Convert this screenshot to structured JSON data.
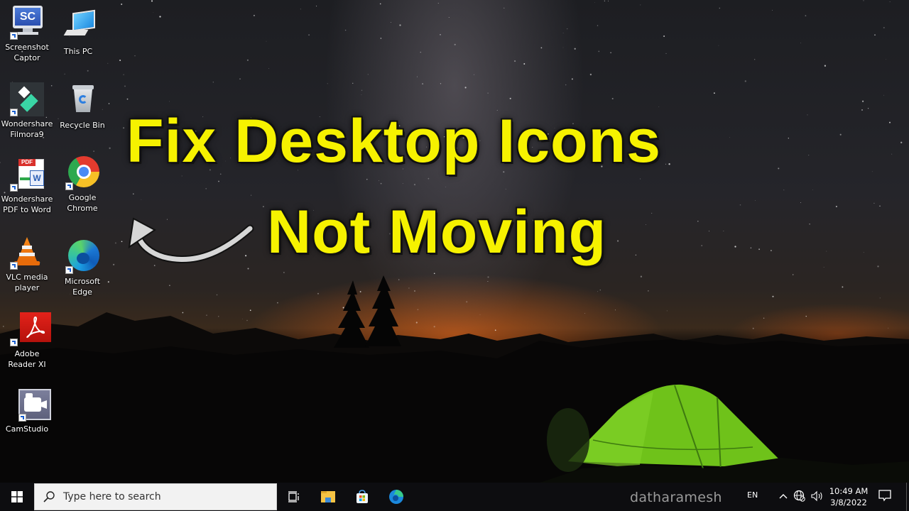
{
  "desktop": {
    "icons": [
      {
        "label_1": "Screenshot",
        "label_2": "Captor",
        "icon": "screenshot-captor-icon"
      },
      {
        "label_1": "This PC",
        "label_2": "",
        "icon": "this-pc-icon"
      },
      {
        "label_1": "Wondershare",
        "label_2": "Filmora9",
        "icon": "filmora-icon"
      },
      {
        "label_1": "Recycle Bin",
        "label_2": "",
        "icon": "recycle-bin-icon"
      },
      {
        "label_1": "Wondershare",
        "label_2": "PDF to Word",
        "icon": "pdf-to-word-icon"
      },
      {
        "label_1": "Google",
        "label_2": "Chrome",
        "icon": "chrome-icon"
      },
      {
        "label_1": "VLC media",
        "label_2": "player",
        "icon": "vlc-icon"
      },
      {
        "label_1": "Microsoft",
        "label_2": "Edge",
        "icon": "edge-icon"
      },
      {
        "label_1": "Adobe",
        "label_2": "Reader XI",
        "icon": "adobe-reader-icon"
      },
      {
        "label_1": "CamStudio",
        "label_2": "",
        "icon": "camstudio-icon"
      }
    ],
    "screenshot_captor_glyph": "SC",
    "pdf_glyph": "PDF",
    "word_glyph": "W"
  },
  "overlay": {
    "headline_line_1": "Fix Desktop Icons",
    "headline_line_2": "Not Moving",
    "headline_color": "#f6f200",
    "watermark": "datharamesh"
  },
  "taskbar": {
    "search_placeholder": "Type here to search",
    "pinned": [
      "task-view",
      "file-explorer",
      "microsoft-store",
      "microsoft-edge"
    ],
    "language": "EN",
    "time": "10:49 AM",
    "date": "3/8/2022"
  }
}
